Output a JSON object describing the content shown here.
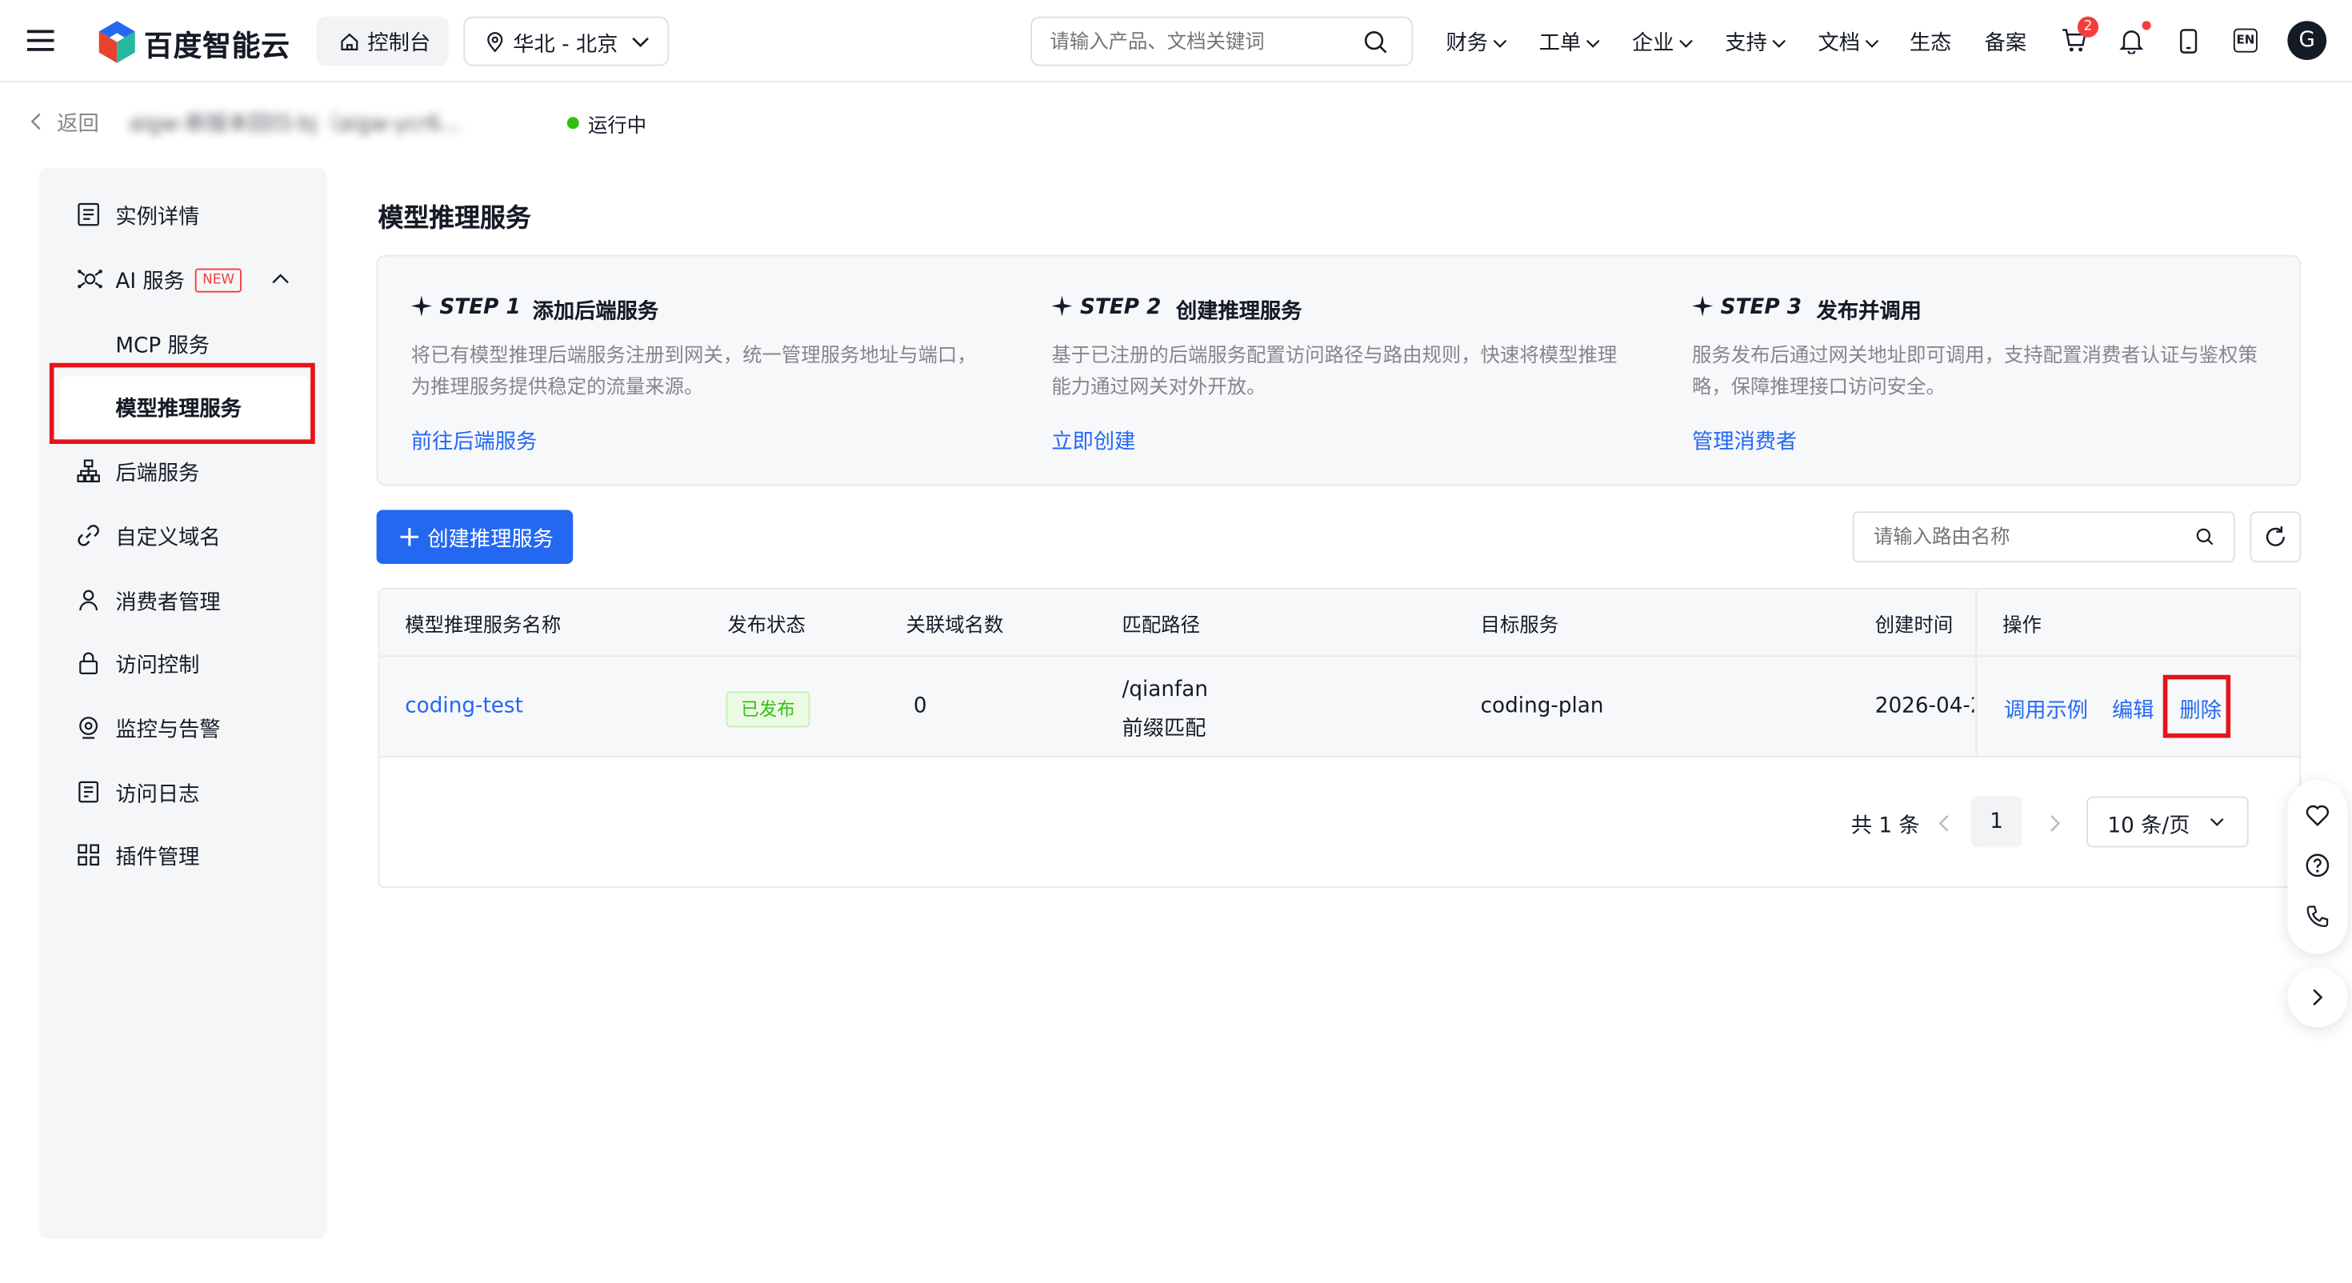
{
  "brand": {
    "logo_text": "百度智能云"
  },
  "topnav": {
    "console_label": "控制台",
    "region_label": "华北 - 北京",
    "search_placeholder": "请输入产品、文档关键词",
    "menu": [
      {
        "label": "财务",
        "has_dropdown": true
      },
      {
        "label": "工单",
        "has_dropdown": true
      },
      {
        "label": "企业",
        "has_dropdown": true
      },
      {
        "label": "支持",
        "has_dropdown": true
      },
      {
        "label": "文档",
        "has_dropdown": true
      },
      {
        "label": "生态",
        "has_dropdown": false
      },
      {
        "label": "备案",
        "has_dropdown": false
      }
    ],
    "cart_badge": "2",
    "lang_label": "EN",
    "avatar_initial": "G"
  },
  "breadcrumb": {
    "back_label": "返回",
    "instance_name": "aigw-新版本回归-bj（aigw-ycr6...",
    "status_label": "运行中",
    "status_color": "#30bf13"
  },
  "sidebar": {
    "items": [
      {
        "label": "实例详情",
        "icon": "document-list-icon"
      },
      {
        "label": "AI 服务",
        "icon": "ai-robot-icon",
        "badge": "NEW",
        "expanded": true
      },
      {
        "label": "MCP 服务",
        "sub": true
      },
      {
        "label": "模型推理服务",
        "sub": true,
        "active": true
      },
      {
        "label": "后端服务",
        "icon": "sitemap-icon"
      },
      {
        "label": "自定义域名",
        "icon": "link-icon"
      },
      {
        "label": "消费者管理",
        "icon": "user-icon"
      },
      {
        "label": "访问控制",
        "icon": "lock-icon"
      },
      {
        "label": "监控与告警",
        "icon": "monitor-target-icon"
      },
      {
        "label": "访问日志",
        "icon": "log-icon"
      },
      {
        "label": "插件管理",
        "icon": "grid-plugin-icon"
      }
    ]
  },
  "page": {
    "title": "模型推理服务"
  },
  "steps": [
    {
      "step": "STEP 1",
      "title": "添加后端服务",
      "desc": "将已有模型推理后端服务注册到网关，统一管理服务地址与端口，为推理服务提供稳定的流量来源。",
      "link": "前往后端服务"
    },
    {
      "step": "STEP 2",
      "title": "创建推理服务",
      "desc": "基于已注册的后端服务配置访问路径与路由规则，快速将模型推理能力通过网关对外开放。",
      "link": "立即创建"
    },
    {
      "step": "STEP 3",
      "title": "发布并调用",
      "desc": "服务发布后通过网关地址即可调用，支持配置消费者认证与鉴权策略，保障推理接口访问安全。",
      "link": "管理消费者"
    }
  ],
  "toolbar": {
    "create_label": "创建推理服务",
    "search_placeholder": "请输入路由名称"
  },
  "table": {
    "columns": [
      "模型推理服务名称",
      "发布状态",
      "关联域名数",
      "匹配路径",
      "目标服务",
      "创建时间",
      "操作"
    ],
    "rows": [
      {
        "name": "coding-test",
        "status": "已发布",
        "domain_count": "0",
        "path": "/qianfan",
        "match_type": "前缀匹配",
        "target": "coding-plan",
        "created": "2026-04-2",
        "actions": [
          "调用示例",
          "编辑",
          "删除"
        ]
      }
    ]
  },
  "pagination": {
    "total_label": "共 1 条",
    "current_page": "1",
    "page_size_label": "10 条/页"
  },
  "colors": {
    "primary": "#2468f2",
    "highlight_box": "#e5141a",
    "published_bg": "#ecfae4",
    "published_text": "#30bf13"
  }
}
